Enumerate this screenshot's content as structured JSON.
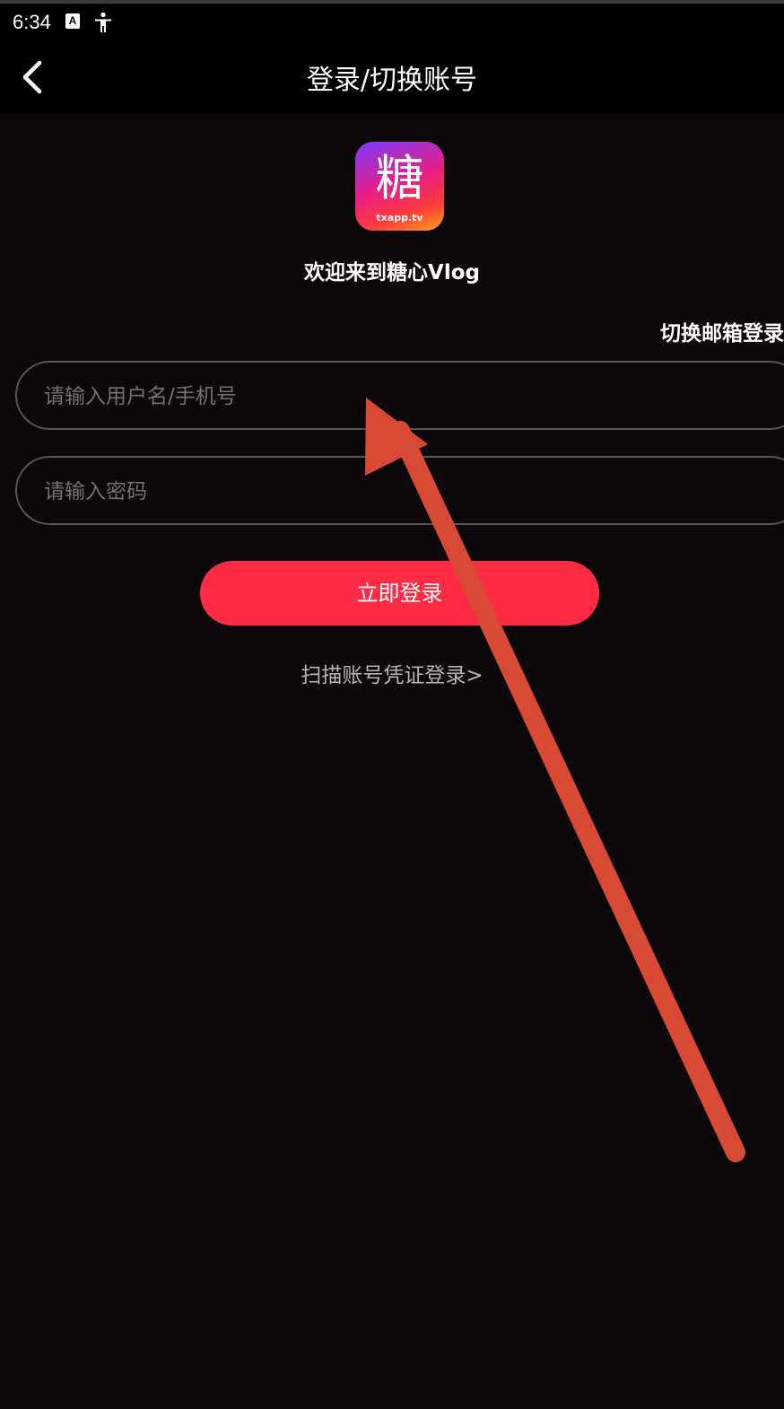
{
  "status_bar": {
    "time": "6:34",
    "icons": [
      "a-box-icon",
      "accessibility-icon"
    ],
    "a_icon_letter": "A"
  },
  "nav": {
    "title": "登录/切换账号",
    "back_icon": "chevron-left-icon"
  },
  "logo": {
    "char": "糖",
    "domain": "txapp.tv"
  },
  "welcome_text": "欢迎来到糖心Vlog",
  "switch_email_label": "切换邮箱登录",
  "form": {
    "username_placeholder": "请输入用户名/手机号",
    "username_value": "",
    "password_placeholder": "请输入密码",
    "password_value": ""
  },
  "login_button_label": "立即登录",
  "scan_link_label": "扫描账号凭证登录>",
  "colors": {
    "background": "#0c0709",
    "accent": "#ff2b44",
    "annotation_arrow": "#d94a34"
  }
}
